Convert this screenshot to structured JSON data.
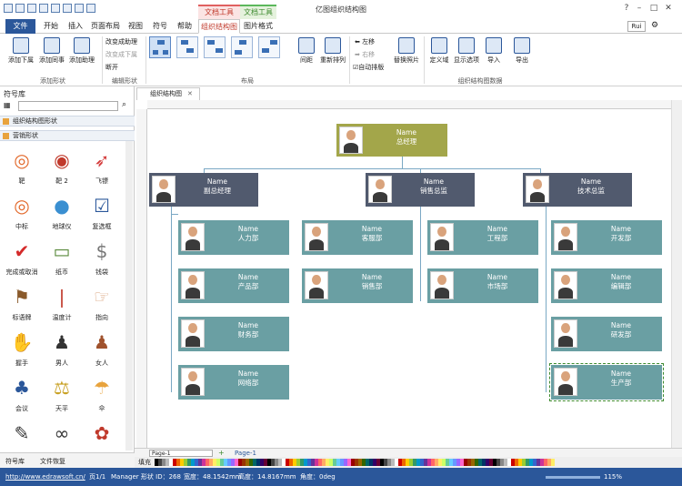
{
  "titlebar": {
    "app_title": "亿图组织结构图",
    "context_group_1": "文档工具",
    "context_group_2": "文档工具",
    "user": "Rui",
    "help_icon": "?"
  },
  "tabs": [
    "文件",
    "开始",
    "插入",
    "页面布局",
    "视图",
    "符号",
    "帮助",
    "组织结构图",
    "图片格式"
  ],
  "ribbon": {
    "add_shape": {
      "btn1": "添加下属",
      "btn2": "添加同事",
      "btn3": "添加助理",
      "label": "添加形状"
    },
    "edit_shape": {
      "item1": "改变成助理",
      "item2": "改变成下属",
      "item3": "断开",
      "label": "编辑形状"
    },
    "layout": {
      "spacing": "间距",
      "rearrange": "重新排列",
      "label": "布局"
    },
    "move": {
      "left": "左移",
      "right": "右移",
      "auto": "自动排版",
      "replace": "替换照片"
    },
    "data": {
      "define": "定义域",
      "show": "显示选项",
      "import": "导入",
      "export": "导出",
      "label": "组织结构图数据"
    }
  },
  "library": {
    "title": "符号库",
    "categories": [
      "组织结构图形状",
      "营销形状"
    ],
    "shapes": [
      "靶",
      "靶 2",
      "飞镖",
      "中标",
      "地球仪",
      "复选框",
      "完成或取消",
      "纸币",
      "钱袋",
      "标语牌",
      "温度计",
      "指向",
      "握手",
      "男人",
      "女人",
      "会议",
      "天平",
      "伞",
      "",
      ""
    ],
    "bottom_tabs": [
      "符号库",
      "文件恢复"
    ]
  },
  "document": {
    "tab": "组织结构图",
    "page_tab": "Page-1",
    "page_active": "Page-1",
    "fill_label": "填充"
  },
  "org": {
    "ceo": {
      "name": "Name",
      "title": "总经理"
    },
    "level2": [
      {
        "name": "Name",
        "title": "副总经理"
      },
      {
        "name": "Name",
        "title": "销售总监"
      },
      {
        "name": "Name",
        "title": "技术总监"
      }
    ],
    "level3": [
      {
        "name": "Name",
        "title": "人力部"
      },
      {
        "name": "Name",
        "title": "产品部"
      },
      {
        "name": "Name",
        "title": "财务部"
      },
      {
        "name": "Name",
        "title": "网络部"
      },
      {
        "name": "Name",
        "title": "客服部"
      },
      {
        "name": "Name",
        "title": "销售部"
      },
      {
        "name": "Name",
        "title": "工程部"
      },
      {
        "name": "Name",
        "title": "市场部"
      },
      {
        "name": "Name",
        "title": "开发部"
      },
      {
        "name": "Name",
        "title": "编辑部"
      },
      {
        "name": "Name",
        "title": "研发部"
      },
      {
        "name": "Name",
        "title": "生产部"
      }
    ]
  },
  "status": {
    "url": "http://www.edrawsoft.cn/",
    "page": "页1/1",
    "shape": "Manager  形状 ID：268",
    "width": "宽度：48.1542mm",
    "height": "高度：14.8167mm",
    "angle": "角度：0deg",
    "zoom": "115%"
  },
  "colors": {
    "ceo": "#a3a64a",
    "level2": "#515a6e",
    "level3": "#6a9fa3",
    "accent": "#2b579a"
  }
}
